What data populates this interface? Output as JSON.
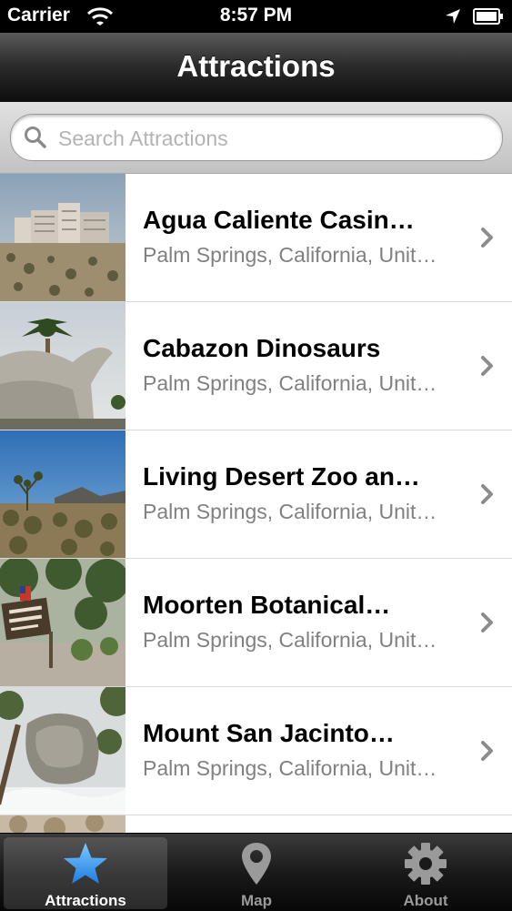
{
  "status_bar": {
    "carrier": "Carrier",
    "time": "8:57 PM"
  },
  "nav": {
    "title": "Attractions"
  },
  "search": {
    "placeholder": "Search Attractions",
    "value": ""
  },
  "items": [
    {
      "title": "Agua Caliente Casin…",
      "subtitle": "Palm Springs, California, Unit…"
    },
    {
      "title": "Cabazon Dinosaurs",
      "subtitle": "Palm Springs, California, Unit…"
    },
    {
      "title": "Living Desert Zoo an…",
      "subtitle": "Palm Springs, California, Unit…"
    },
    {
      "title": "Moorten Botanical…",
      "subtitle": "Palm Springs, California, Unit…"
    },
    {
      "title": "Mount San Jacinto…",
      "subtitle": "Palm Springs, California, Unit…"
    }
  ],
  "tabs": [
    {
      "label": "Attractions",
      "icon": "star-icon",
      "active": true
    },
    {
      "label": "Map",
      "icon": "map-pin-icon",
      "active": false
    },
    {
      "label": "About",
      "icon": "gear-icon",
      "active": false
    }
  ],
  "colors": {
    "tab_active_icon": "#3b9cf0",
    "tab_inactive_icon": "#9a9a9a",
    "subtitle_text": "#808080"
  }
}
